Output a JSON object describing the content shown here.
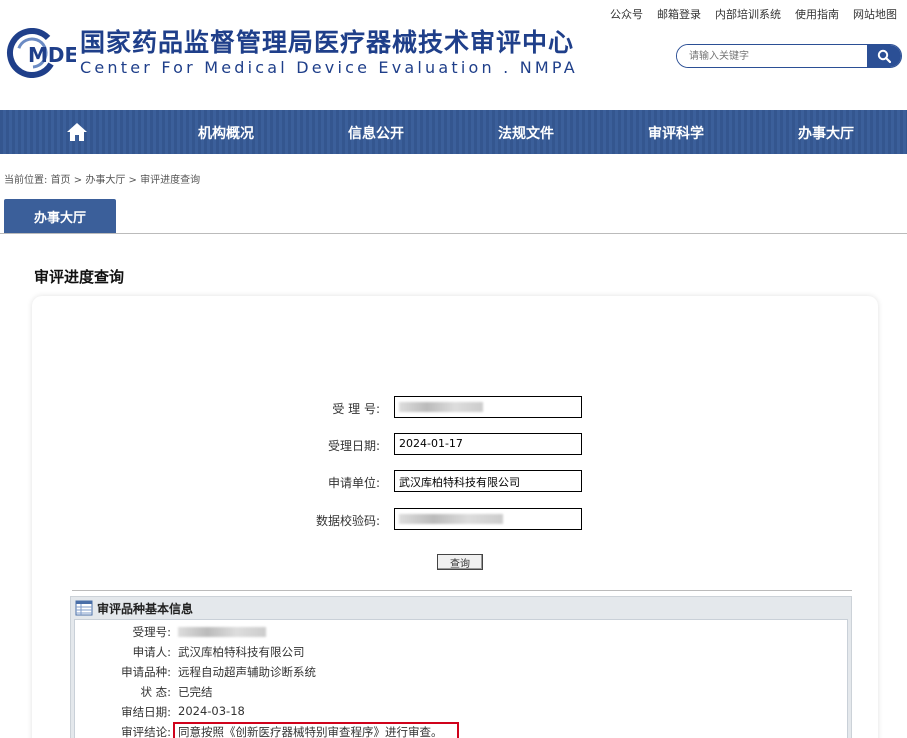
{
  "top_links": [
    "公众号",
    "邮箱登录",
    "内部培训系统",
    "使用指南",
    "网站地图"
  ],
  "logo": {
    "mark_text": "MDE",
    "cn": "国家药品监督管理局医疗器械技术审评中心",
    "en": "Center For Medical Device Evaluation . NMPA"
  },
  "search": {
    "placeholder": "请输入关键字",
    "icon": "search-icon"
  },
  "nav": {
    "home_icon": "home-icon",
    "items": [
      "机构概况",
      "信息公开",
      "法规文件",
      "审评科学",
      "办事大厅"
    ]
  },
  "breadcrumb": {
    "prefix": "当前位置:",
    "items": [
      "首页",
      "办事大厅",
      "审评进度查询"
    ],
    "separator": ">"
  },
  "tab": {
    "label": "办事大厅"
  },
  "section_title": "审评进度查询",
  "form": {
    "fields": [
      {
        "label": "受 理 号:",
        "value": ""
      },
      {
        "label": "受理日期:",
        "value": "2024-01-17"
      },
      {
        "label": "申请单位:",
        "value": "武汉库柏特科技有限公司"
      },
      {
        "label": "数据校验码:",
        "value": ""
      }
    ],
    "query_button": "查询"
  },
  "info": {
    "header": "审评品种基本信息",
    "header_icon": "table-icon",
    "rows": [
      {
        "label": "受理号:",
        "value": ""
      },
      {
        "label": "申请人:",
        "value": "武汉库柏特科技有限公司"
      },
      {
        "label": "申请品种:",
        "value": "远程自动超声辅助诊断系统"
      },
      {
        "label": "状 态:",
        "value": "已完结"
      },
      {
        "label": "审结日期:",
        "value": "2024-03-18"
      },
      {
        "label": "审评结论:",
        "value": "同意按照《创新医疗器械特别审查程序》进行审查。"
      }
    ],
    "highlight_color": "#d0021b"
  },
  "colors": {
    "brand": "#1f3f8a",
    "nav": "#3b5f9a"
  }
}
